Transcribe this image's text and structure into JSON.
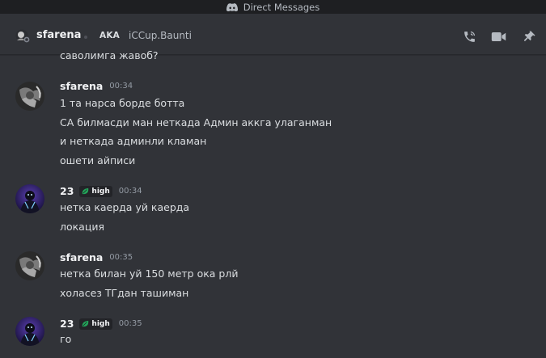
{
  "titlebar": {
    "title": "Direct Messages",
    "icon": "discord-icon"
  },
  "header": {
    "username": "sfarena",
    "aka_badge": "AKA",
    "aka_name": "iCCup.Baunti",
    "icons": [
      "voice-call-icon",
      "video-call-icon",
      "pin-icon"
    ]
  },
  "messages": {
    "partial_line": "саволимга жавоб?",
    "groups": [
      {
        "author": "sfarena",
        "time": "00:34",
        "lines": [
          "1 та нарса борде ботта",
          "СА билмасди ман неткада Админ аккга улаганман",
          "и неткада админли кламан",
          "ошети айписи"
        ]
      },
      {
        "author": "23",
        "tag": "high",
        "time": "00:34",
        "lines": [
          "нетка каерда уй каерда",
          "локация"
        ]
      },
      {
        "author": "sfarena",
        "time": "00:35",
        "lines": [
          "нетка билан уй 150 метр ока рлй",
          "холасез ТГдан ташиман"
        ]
      },
      {
        "author": "23",
        "tag": "high",
        "time": "00:35",
        "lines": [
          "го"
        ]
      }
    ]
  },
  "colors": {
    "background": "#313338",
    "titlebar": "#1e1f22",
    "text": "#dbdee1",
    "muted": "#949ba4",
    "tag_leaf": "#23a55a"
  }
}
